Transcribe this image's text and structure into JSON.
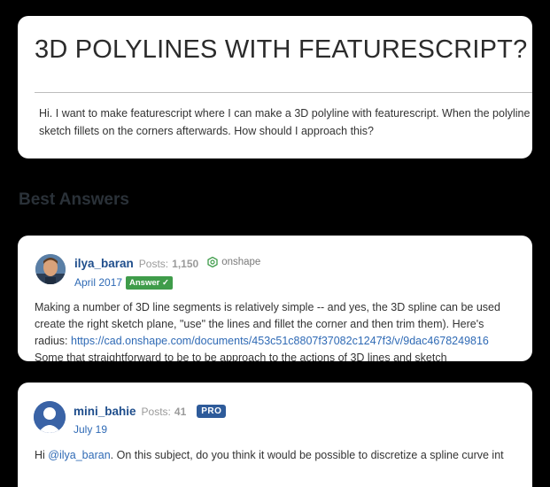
{
  "question": {
    "title": "3D POLYLINES WITH FEATURESCRIPT?",
    "body_line_1": "Hi. I want to make featurescript where I can make a 3D polyline with featurescript. When the polyline",
    "body_line_2": "sketch fillets on the corners afterwards. How should I approach this?"
  },
  "best_answers": {
    "heading": "Best Answers"
  },
  "answers": [
    {
      "username": "ilya_baran",
      "posts_label": "Posts:",
      "posts_count": "1,150",
      "org": "onshape",
      "date": "April 2017",
      "badge": "Answer ✓",
      "line_1": "Making a number of 3D line segments is relatively simple -- and yes, the 3D spline can be used",
      "line_2": "create the right sketch plane, \"use\" the lines and fillet the corner and then trim them).  Here's",
      "line_3_prefix": "radius: ",
      "link": "https://cad.onshape.com/documents/453c51c8807f37082c1247f3/v/9dac4678249816",
      "line_4": "Some that straightforward to be to be approach to the actions of 3D lines and sketch"
    },
    {
      "username": "mini_bahie",
      "posts_label": "Posts:",
      "posts_count": "41",
      "badge": "PRO",
      "date": "July 19",
      "text_prefix": "Hi ",
      "mention": "@ilya_baran",
      "text_rest": ". On this subject, do you think it would be possible to discretize a spline curve int"
    }
  ],
  "colors": {
    "background": "#000000",
    "card": "#ffffff",
    "link": "#2f6ab5",
    "username": "#1f4e8c",
    "answer_badge": "#3f9c4a",
    "pro_badge": "#2e5b9a"
  }
}
